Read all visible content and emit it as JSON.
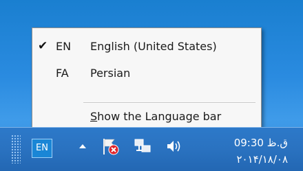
{
  "menu": {
    "items": [
      {
        "checked": true,
        "check_mark": "✔",
        "code": "EN",
        "label": "English (United States)"
      },
      {
        "checked": false,
        "check_mark": "",
        "code": "FA",
        "label": "Persian"
      }
    ],
    "show_langbar": {
      "accel": "S",
      "rest": "how the Language bar"
    }
  },
  "taskbar": {
    "lang_indicator": "EN",
    "tray_icons": [
      "show-hidden-icons-arrow-icon",
      "action-center-flag-icon",
      "network-icon",
      "volume-icon"
    ],
    "clock": {
      "time": "09:30 ق.ظ",
      "date": "۲۰۱۴/۱۸/۰۸"
    }
  },
  "colors": {
    "desktop": "#2a8be0",
    "taskbar": "#2a72c0",
    "menu_bg": "#f7f7f7",
    "flag_x": "#e0252b"
  }
}
